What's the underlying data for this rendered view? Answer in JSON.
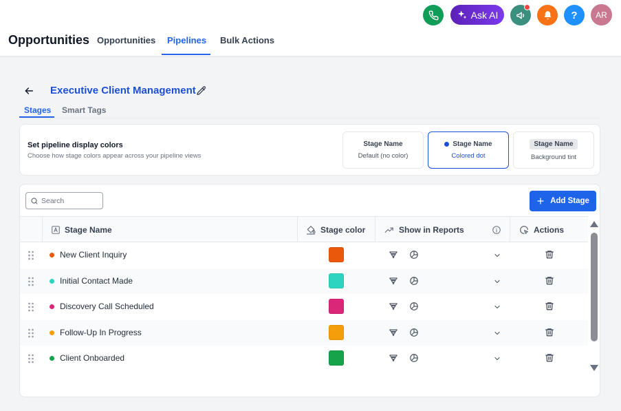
{
  "header": {
    "app_title": "Opportunities",
    "tabs": [
      {
        "label": "Opportunities",
        "active": false
      },
      {
        "label": "Pipelines",
        "active": true
      },
      {
        "label": "Bulk Actions",
        "active": false
      }
    ],
    "ask_ai_label": "Ask AI",
    "avatar_initials": "AR",
    "help_label": "?",
    "icons": [
      "phone-icon",
      "sparkle-icon",
      "megaphone-icon",
      "bell-icon",
      "help-icon"
    ],
    "colors": {
      "phone": "#0f9d58",
      "megaphone": "#3a8f7e",
      "bell": "#f97316",
      "help": "#1e90ff"
    }
  },
  "page": {
    "pipeline_title": "Executive Client Management",
    "sub_tabs": [
      {
        "label": "Stages",
        "active": true
      },
      {
        "label": "Smart Tags",
        "active": false
      }
    ]
  },
  "color_panel": {
    "title": "Set pipeline display colors",
    "description": "Choose how stage colors appear across your pipeline views",
    "options": [
      {
        "name": "Stage Name",
        "sub": "Default (no color)",
        "selected": false
      },
      {
        "name": "Stage Name",
        "sub": "Colored dot",
        "selected": true
      },
      {
        "name": "Stage Name",
        "sub": "Background tint",
        "selected": false
      }
    ]
  },
  "table": {
    "search_placeholder": "Search",
    "add_stage_label": "Add Stage",
    "columns": {
      "stage_name": "Stage Name",
      "stage_color": "Stage color",
      "show_in_reports": "Show in Reports",
      "actions": "Actions"
    },
    "rows": [
      {
        "name": "New Client Inquiry",
        "color": "#ea580c"
      },
      {
        "name": "Initial Contact Made",
        "color": "#2dd4bf"
      },
      {
        "name": "Discovery Call Scheduled",
        "color": "#db2777"
      },
      {
        "name": "Follow-Up In Progress",
        "color": "#f59e0b"
      },
      {
        "name": "Client Onboarded",
        "color": "#16a34a"
      }
    ]
  }
}
